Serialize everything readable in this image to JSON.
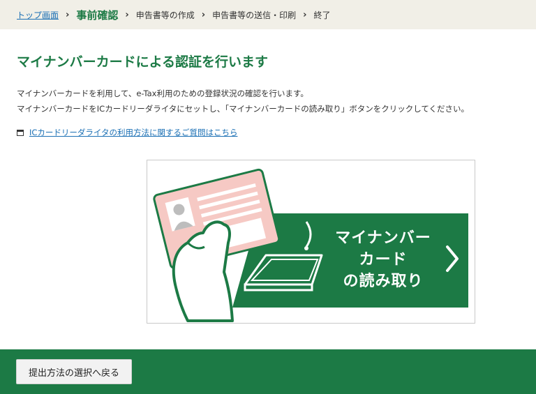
{
  "breadcrumb": {
    "top_link": "トップ画面",
    "separator": "›",
    "current": "事前確認",
    "step2": "申告書等の作成",
    "step3": "申告書等の送信・印刷",
    "step4": "終了"
  },
  "page": {
    "title": "マイナンバーカードによる認証を行います",
    "description_line1": "マイナンバーカードを利用して、e-Tax利用のための登録状況の確認を行います。",
    "description_line2": "マイナンバーカードをICカードリーダライタにセットし、「マイナンバーカードの読み取り」ボタンをクリックしてください。",
    "help_link": "ICカードリーダライタの利用方法に関するご質問はこちら"
  },
  "card_reader_button": {
    "line1": "マイナンバー",
    "line2": "カード",
    "line3": "の読み取り",
    "arrow_icon": "chevron-right-icon"
  },
  "footer": {
    "back_button": "提出方法の選択へ戻る"
  },
  "colors": {
    "accent_green": "#1c7a45",
    "breadcrumb_bg": "#f1efe7",
    "link_blue": "#1a6fb4",
    "card_pink": "#f6c9c4"
  }
}
